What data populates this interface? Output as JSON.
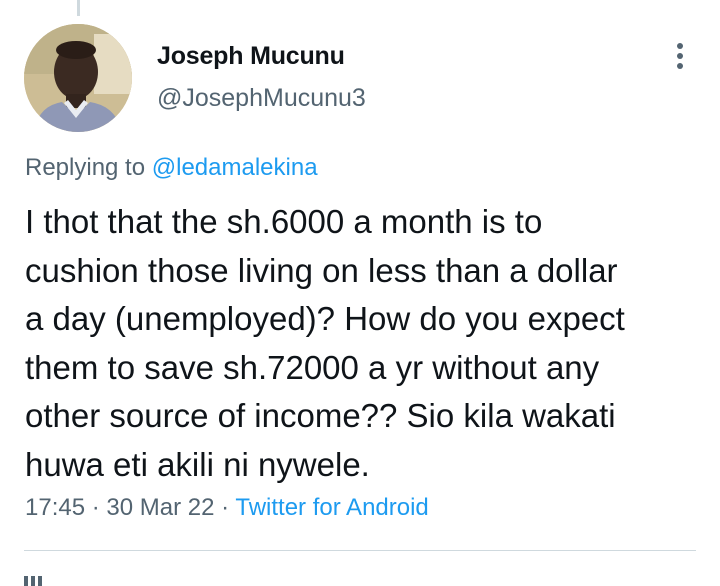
{
  "author": {
    "name": "Joseph Mucunu",
    "handle": "@JosephMucunu3"
  },
  "reply": {
    "prefix": "Replying to",
    "mention": "@ledamalekina"
  },
  "tweet": {
    "text": "I thot that the sh.6000 a month is to\ncushion those living on less than a dollar\na day (unemployed)? How do you expect\nthem to save sh.72000 a yr without any\nother source of income?? Sio kila wakati\nhuwa eti akili ni nywele."
  },
  "meta": {
    "time": "17:45",
    "separator1": " · ",
    "date": "30 Mar 22",
    "separator2": " · ",
    "source": "Twitter for Android"
  },
  "icons": {
    "more": "more-vertical-icon"
  },
  "colors": {
    "text": "#0f1419",
    "secondary": "#536471",
    "link": "#1d9bf0",
    "divider": "#cfd9de"
  }
}
